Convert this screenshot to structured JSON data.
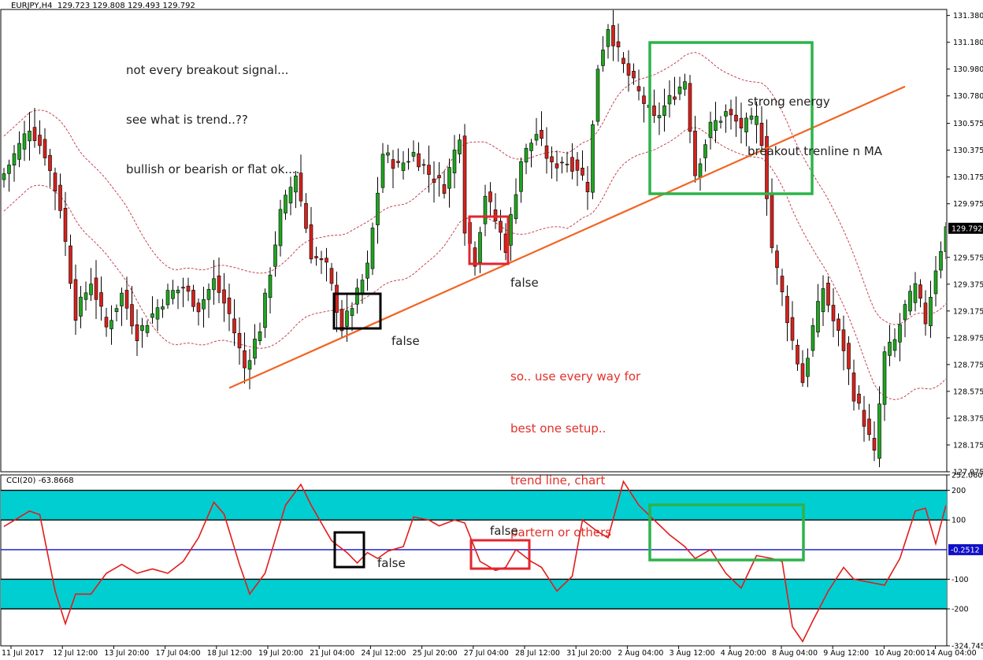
{
  "header": {
    "symbol": "EURJPY,H4",
    "ohlc": "129.723 129.808 129.493 129.792",
    "indicator": "CCI(20) -63.8668"
  },
  "annotations": {
    "note_lines": [
      "not every breakout signal...",
      "see what is trend..??",
      "bullish or bearish or flat ok...."
    ],
    "energy_lines": [
      "strong energy",
      "breakout trenline n MA"
    ],
    "setup_lines": [
      "so.. use every way for",
      "best one setup..",
      "trend line, chart",
      "partern or others"
    ],
    "false_black": "false",
    "false_red": "false",
    "false_cci_black": "false",
    "false_cci_red": "false"
  },
  "colors": {
    "bull": "#1fa51f",
    "bear": "#d6221c",
    "trendline": "#f26422",
    "ma": "#c03040",
    "cci_line": "#e31b1b",
    "cci_band": "#00ced1",
    "cci_zero": "#1010c8",
    "box_black": "#000000",
    "box_red": "#e3262f",
    "box_green": "#2db34a"
  },
  "chart_data": [
    {
      "type": "candlestick",
      "symbol": "EURJPY",
      "timeframe": "H4",
      "ylim": [
        127.975,
        131.425
      ],
      "price_ticks": [
        "131.380",
        "131.180",
        "130.980",
        "130.780",
        "130.575",
        "130.375",
        "130.175",
        "129.975",
        "129.792",
        "129.575",
        "129.375",
        "129.175",
        "128.975",
        "128.775",
        "128.575",
        "128.375",
        "128.175",
        "127.975"
      ],
      "current_price": "129.792",
      "time_ticks": [
        "11 Jul 2017",
        "12 Jul 12:00",
        "13 Jul 20:00",
        "17 Jul 04:00",
        "18 Jul 12:00",
        "19 Jul 20:00",
        "21 Jul 04:00",
        "24 Jul 12:00",
        "25 Jul 20:00",
        "27 Jul 04:00",
        "28 Jul 12:00",
        "31 Jul 20:00",
        "2 Aug 04:00",
        "3 Aug 12:00",
        "4 Aug 20:00",
        "8 Aug 04:00",
        "9 Aug 12:00",
        "10 Aug 20:00",
        "14 Aug 04:00"
      ],
      "path_close": [
        [
          0,
          130.2
        ],
        [
          5,
          130.55
        ],
        [
          8,
          130.35
        ],
        [
          11,
          129.95
        ],
        [
          14,
          129.15
        ],
        [
          17,
          129.4
        ],
        [
          20,
          129.05
        ],
        [
          23,
          129.3
        ],
        [
          26,
          129.0
        ],
        [
          29,
          129.15
        ],
        [
          32,
          129.3
        ],
        [
          35,
          129.35
        ],
        [
          38,
          129.2
        ],
        [
          41,
          129.4
        ],
        [
          44,
          129.15
        ],
        [
          47,
          128.75
        ],
        [
          50,
          129.05
        ],
        [
          54,
          129.9
        ],
        [
          57,
          130.2
        ],
        [
          60,
          129.6
        ],
        [
          63,
          129.5
        ],
        [
          66,
          129.05
        ],
        [
          69,
          129.3
        ],
        [
          71,
          129.5
        ],
        [
          74,
          130.35
        ],
        [
          77,
          130.25
        ],
        [
          80,
          130.35
        ],
        [
          83,
          130.2
        ],
        [
          86,
          130.1
        ],
        [
          89,
          130.5
        ],
        [
          90,
          129.8
        ],
        [
          92,
          129.55
        ],
        [
          94,
          130.05
        ],
        [
          96,
          129.85
        ],
        [
          98,
          129.65
        ],
        [
          101,
          130.3
        ],
        [
          104,
          130.5
        ],
        [
          107,
          130.25
        ],
        [
          109,
          130.3
        ],
        [
          112,
          130.25
        ],
        [
          114,
          130.1
        ],
        [
          116,
          131.0
        ],
        [
          118,
          131.3
        ],
        [
          121,
          131.0
        ],
        [
          124,
          130.8
        ],
        [
          127,
          130.6
        ],
        [
          130,
          130.75
        ],
        [
          133,
          130.9
        ],
        [
          135,
          130.2
        ],
        [
          138,
          130.55
        ],
        [
          141,
          130.65
        ],
        [
          144,
          130.55
        ],
        [
          147,
          130.6
        ],
        [
          148,
          130.45
        ],
        [
          150,
          129.65
        ],
        [
          152,
          129.3
        ],
        [
          154,
          128.95
        ],
        [
          156,
          128.65
        ],
        [
          158,
          129.05
        ],
        [
          160,
          129.35
        ],
        [
          162,
          129.1
        ],
        [
          164,
          128.9
        ],
        [
          166,
          128.55
        ],
        [
          168,
          128.35
        ],
        [
          170,
          128.1
        ],
        [
          172,
          128.85
        ],
        [
          174,
          128.95
        ],
        [
          176,
          129.2
        ],
        [
          178,
          129.35
        ],
        [
          180,
          129.1
        ],
        [
          182,
          129.5
        ],
        [
          184,
          129.792
        ]
      ],
      "moving_average_envelope": "dashed upper and lower bands following the trend",
      "trendline": {
        "from": [
          44,
          128.6
        ],
        "to": [
          176,
          130.85
        ]
      }
    },
    {
      "type": "line",
      "name": "CCI(20)",
      "current_value": -63.8668,
      "ylim": [
        -324.7451,
        252.0607
      ],
      "levels": [
        200,
        100,
        -0.2512,
        -100,
        -200
      ],
      "tick_labels": [
        "252.0607",
        "200",
        "100",
        "-0.2512",
        "-100",
        "-200",
        "-324.7451"
      ],
      "path": [
        [
          0,
          78
        ],
        [
          5,
          130
        ],
        [
          7,
          118
        ],
        [
          10,
          -140
        ],
        [
          12,
          -250
        ],
        [
          14,
          -150
        ],
        [
          17,
          -150
        ],
        [
          20,
          -80
        ],
        [
          23,
          -50
        ],
        [
          26,
          -80
        ],
        [
          29,
          -65
        ],
        [
          32,
          -80
        ],
        [
          35,
          -40
        ],
        [
          38,
          40
        ],
        [
          41,
          160
        ],
        [
          43,
          120
        ],
        [
          46,
          -50
        ],
        [
          48,
          -150
        ],
        [
          51,
          -80
        ],
        [
          55,
          150
        ],
        [
          58,
          220
        ],
        [
          60,
          150
        ],
        [
          64,
          30
        ],
        [
          67,
          -10
        ],
        [
          69,
          -45
        ],
        [
          71,
          -10
        ],
        [
          73,
          -30
        ],
        [
          75,
          -5
        ],
        [
          78,
          10
        ],
        [
          80,
          110
        ],
        [
          83,
          100
        ],
        [
          85,
          80
        ],
        [
          88,
          100
        ],
        [
          90,
          90
        ],
        [
          93,
          -40
        ],
        [
          96,
          -70
        ],
        [
          98,
          -60
        ],
        [
          100,
          0
        ],
        [
          103,
          -40
        ],
        [
          105,
          -60
        ],
        [
          108,
          -140
        ],
        [
          111,
          -90
        ],
        [
          113,
          100
        ],
        [
          116,
          60
        ],
        [
          118,
          40
        ],
        [
          121,
          230
        ],
        [
          124,
          150
        ],
        [
          127,
          100
        ],
        [
          130,
          50
        ],
        [
          133,
          10
        ],
        [
          135,
          -30
        ],
        [
          138,
          0
        ],
        [
          141,
          -80
        ],
        [
          144,
          -130
        ],
        [
          147,
          -20
        ],
        [
          150,
          -30
        ],
        [
          152,
          -40
        ],
        [
          154,
          -260
        ],
        [
          156,
          -310
        ],
        [
          158,
          -240
        ],
        [
          161,
          -140
        ],
        [
          164,
          -60
        ],
        [
          166,
          -100
        ],
        [
          169,
          -110
        ],
        [
          172,
          -120
        ],
        [
          175,
          -30
        ],
        [
          178,
          130
        ],
        [
          180,
          140
        ],
        [
          182,
          20
        ],
        [
          184,
          150
        ]
      ]
    }
  ]
}
